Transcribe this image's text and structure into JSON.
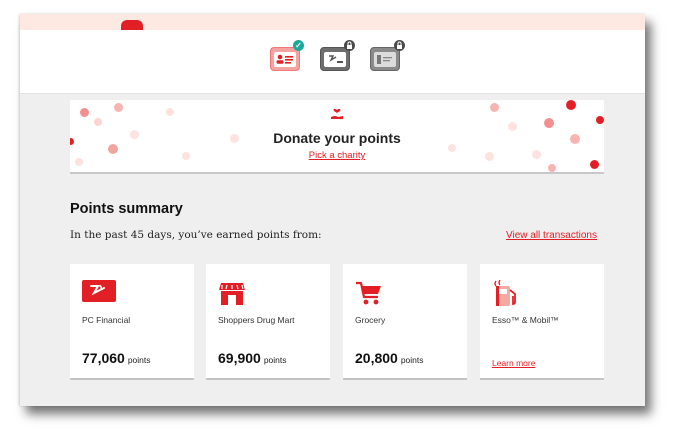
{
  "cards": [
    {
      "name": "pc-optimum-card",
      "status": "selected"
    },
    {
      "name": "pc-financial-card",
      "status": "locked"
    },
    {
      "name": "shoppers-card",
      "status": "locked"
    }
  ],
  "donate": {
    "title": "Donate your points",
    "link": "Pick a charity"
  },
  "summary": {
    "title": "Points summary",
    "subtitle": "In the past 45 days, you’ve earned points from:",
    "view_all": "View all transactions"
  },
  "tiles": [
    {
      "name": "PC Financial",
      "points": "77,060",
      "unit": "points",
      "icon": "pc-financial-logo-icon"
    },
    {
      "name": "Shoppers Drug Mart",
      "points": "69,900",
      "unit": "points",
      "icon": "store-icon"
    },
    {
      "name": "Grocery",
      "points": "20,800",
      "unit": "points",
      "icon": "shopping-cart-icon"
    },
    {
      "name": "Esso™ & Mobil™",
      "link": "Learn more",
      "icon": "gas-pump-icon"
    }
  ],
  "colors": {
    "accent": "#e31f26",
    "background": "#efefef",
    "check_badge": "#1aa89a"
  }
}
